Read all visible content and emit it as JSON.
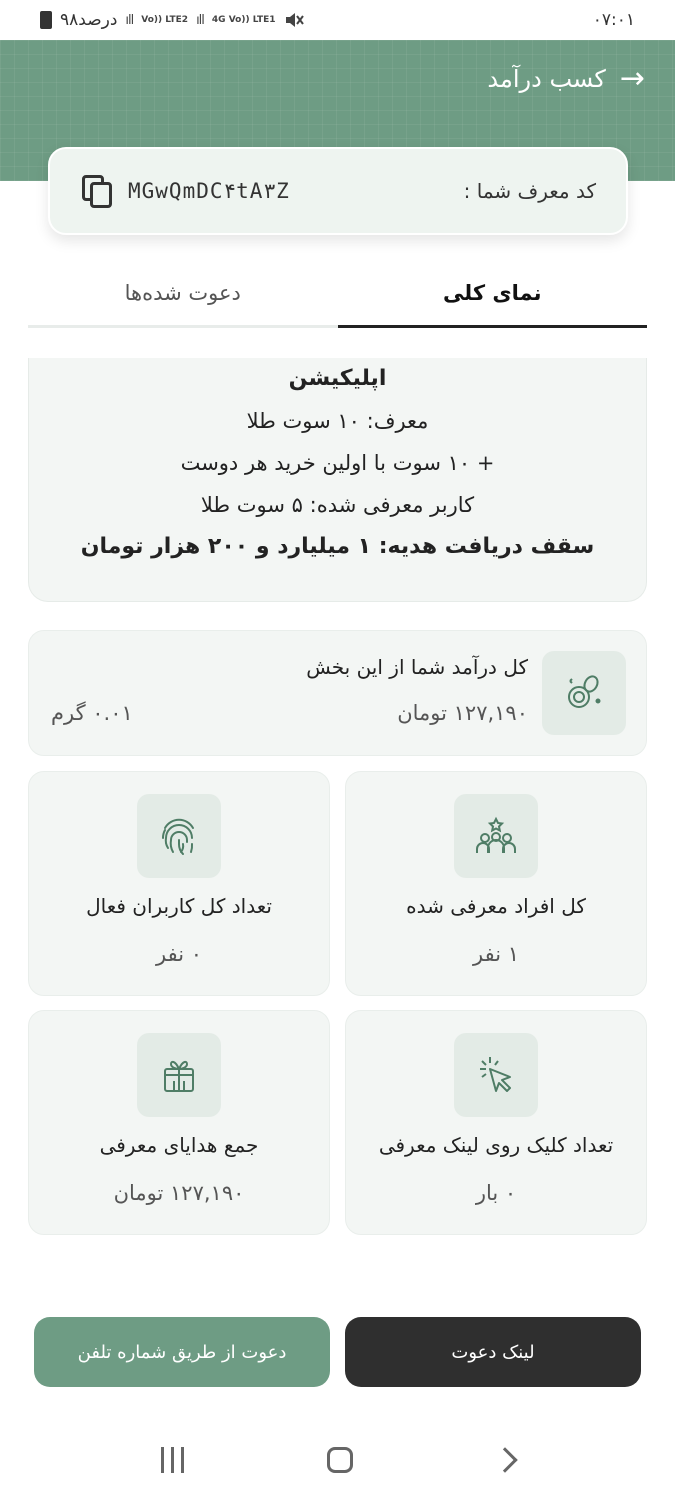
{
  "status_bar": {
    "time": "۰۷:۰۱",
    "battery": "۹۸درصد",
    "network_1": "Vo)) LTE2",
    "network_2": "4G Vo)) LTE1"
  },
  "header": {
    "title": "کسب درآمد"
  },
  "referral": {
    "label": "کد معرف شما :",
    "code": "MGwQmDC۴tA۳Z"
  },
  "tabs": [
    {
      "label": "دعوت شده‌ها",
      "active": false
    },
    {
      "label": "نمای کلی",
      "active": true
    }
  ],
  "info": {
    "lines": [
      "اپلیکیشن",
      "معرف: ۱۰ سوت طلا",
      "+ ۱۰ سوت با اولین خرید هر دوست",
      "کاربر معرفی شده: ۵ سوت طلا",
      "سقف دریافت هدیه: ۱ میلیارد و ۲۰۰ هزار تومان"
    ]
  },
  "total": {
    "title": "کل درآمد شما از این بخش",
    "toman": "۱۲۷,۱۹۰ تومان",
    "gram": "۰.۰۱ گرم",
    "icon": "coins-icon"
  },
  "stats": {
    "invited": {
      "label": "کل افراد معرفی شده",
      "value": "۱ نفر",
      "icon": "people-icon"
    },
    "active": {
      "label": "تعداد کل کاربران فعال",
      "value": "۰ نفر",
      "icon": "fingerprint-icon"
    },
    "clicks": {
      "label": "تعداد کلیک روی لینک معرفی",
      "value": "۰ بار",
      "icon": "cursor-click-icon"
    },
    "gifts": {
      "label": "جمع هدایای معرفی",
      "value": "۱۲۷,۱۹۰ تومان",
      "icon": "gift-icon"
    }
  },
  "buttons": {
    "invite_link": "لینک دعوت",
    "invite_phone": "دعوت از طریق شماره تلفن"
  },
  "colors": {
    "brand_green": "#6e9c84",
    "dark_button": "#2f2f2f",
    "card_bg": "#f3f6f4"
  }
}
